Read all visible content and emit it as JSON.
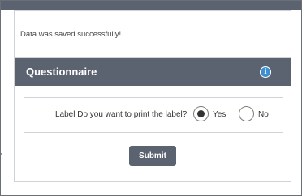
{
  "alert": {
    "message": "Data was saved successfully!"
  },
  "questionnaire": {
    "title": "Questionnaire",
    "info_icon": "info-icon",
    "question_label": "Label Do you want to print the label?",
    "options": [
      {
        "label": "Yes",
        "selected": true
      },
      {
        "label": "No",
        "selected": false
      }
    ],
    "submit_label": "Submit"
  },
  "colors": {
    "header_bg": "#5c6370",
    "info_icon": "#3d8fd1",
    "border": "#cfd3d8"
  }
}
